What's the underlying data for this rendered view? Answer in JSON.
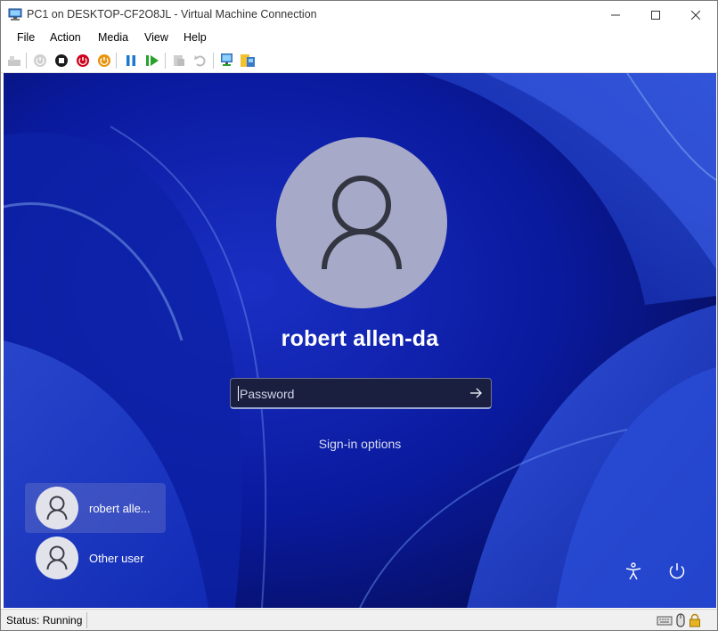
{
  "window": {
    "title": "PC1 on DESKTOP-CF2O8JL - Virtual Machine Connection",
    "minimize_glyph": "—",
    "maximize_glyph": "☐",
    "close_glyph": "✕"
  },
  "menu": {
    "file": "File",
    "action": "Action",
    "media": "Media",
    "view": "View",
    "help": "Help"
  },
  "toolbar": {
    "icons": [
      "ctrl-alt-del-icon",
      "start-icon",
      "turn-off-icon",
      "shut-down-icon",
      "save-icon",
      "pause-icon",
      "resume-icon",
      "checkpoint-icon",
      "revert-icon",
      "enhanced-session-icon",
      "share-icon"
    ]
  },
  "login": {
    "username": "robert allen-da",
    "password_placeholder": "Password",
    "sign_in_options": "Sign-in options",
    "users": [
      {
        "label": "robert alle...",
        "selected": true
      },
      {
        "label": "Other user",
        "selected": false
      }
    ]
  },
  "status": {
    "text": "Status: Running"
  },
  "colors": {
    "wallpaper": "#0a1a9e",
    "avatar_bg": "#a6a9c7",
    "password_bg": "#1a1f3f"
  }
}
